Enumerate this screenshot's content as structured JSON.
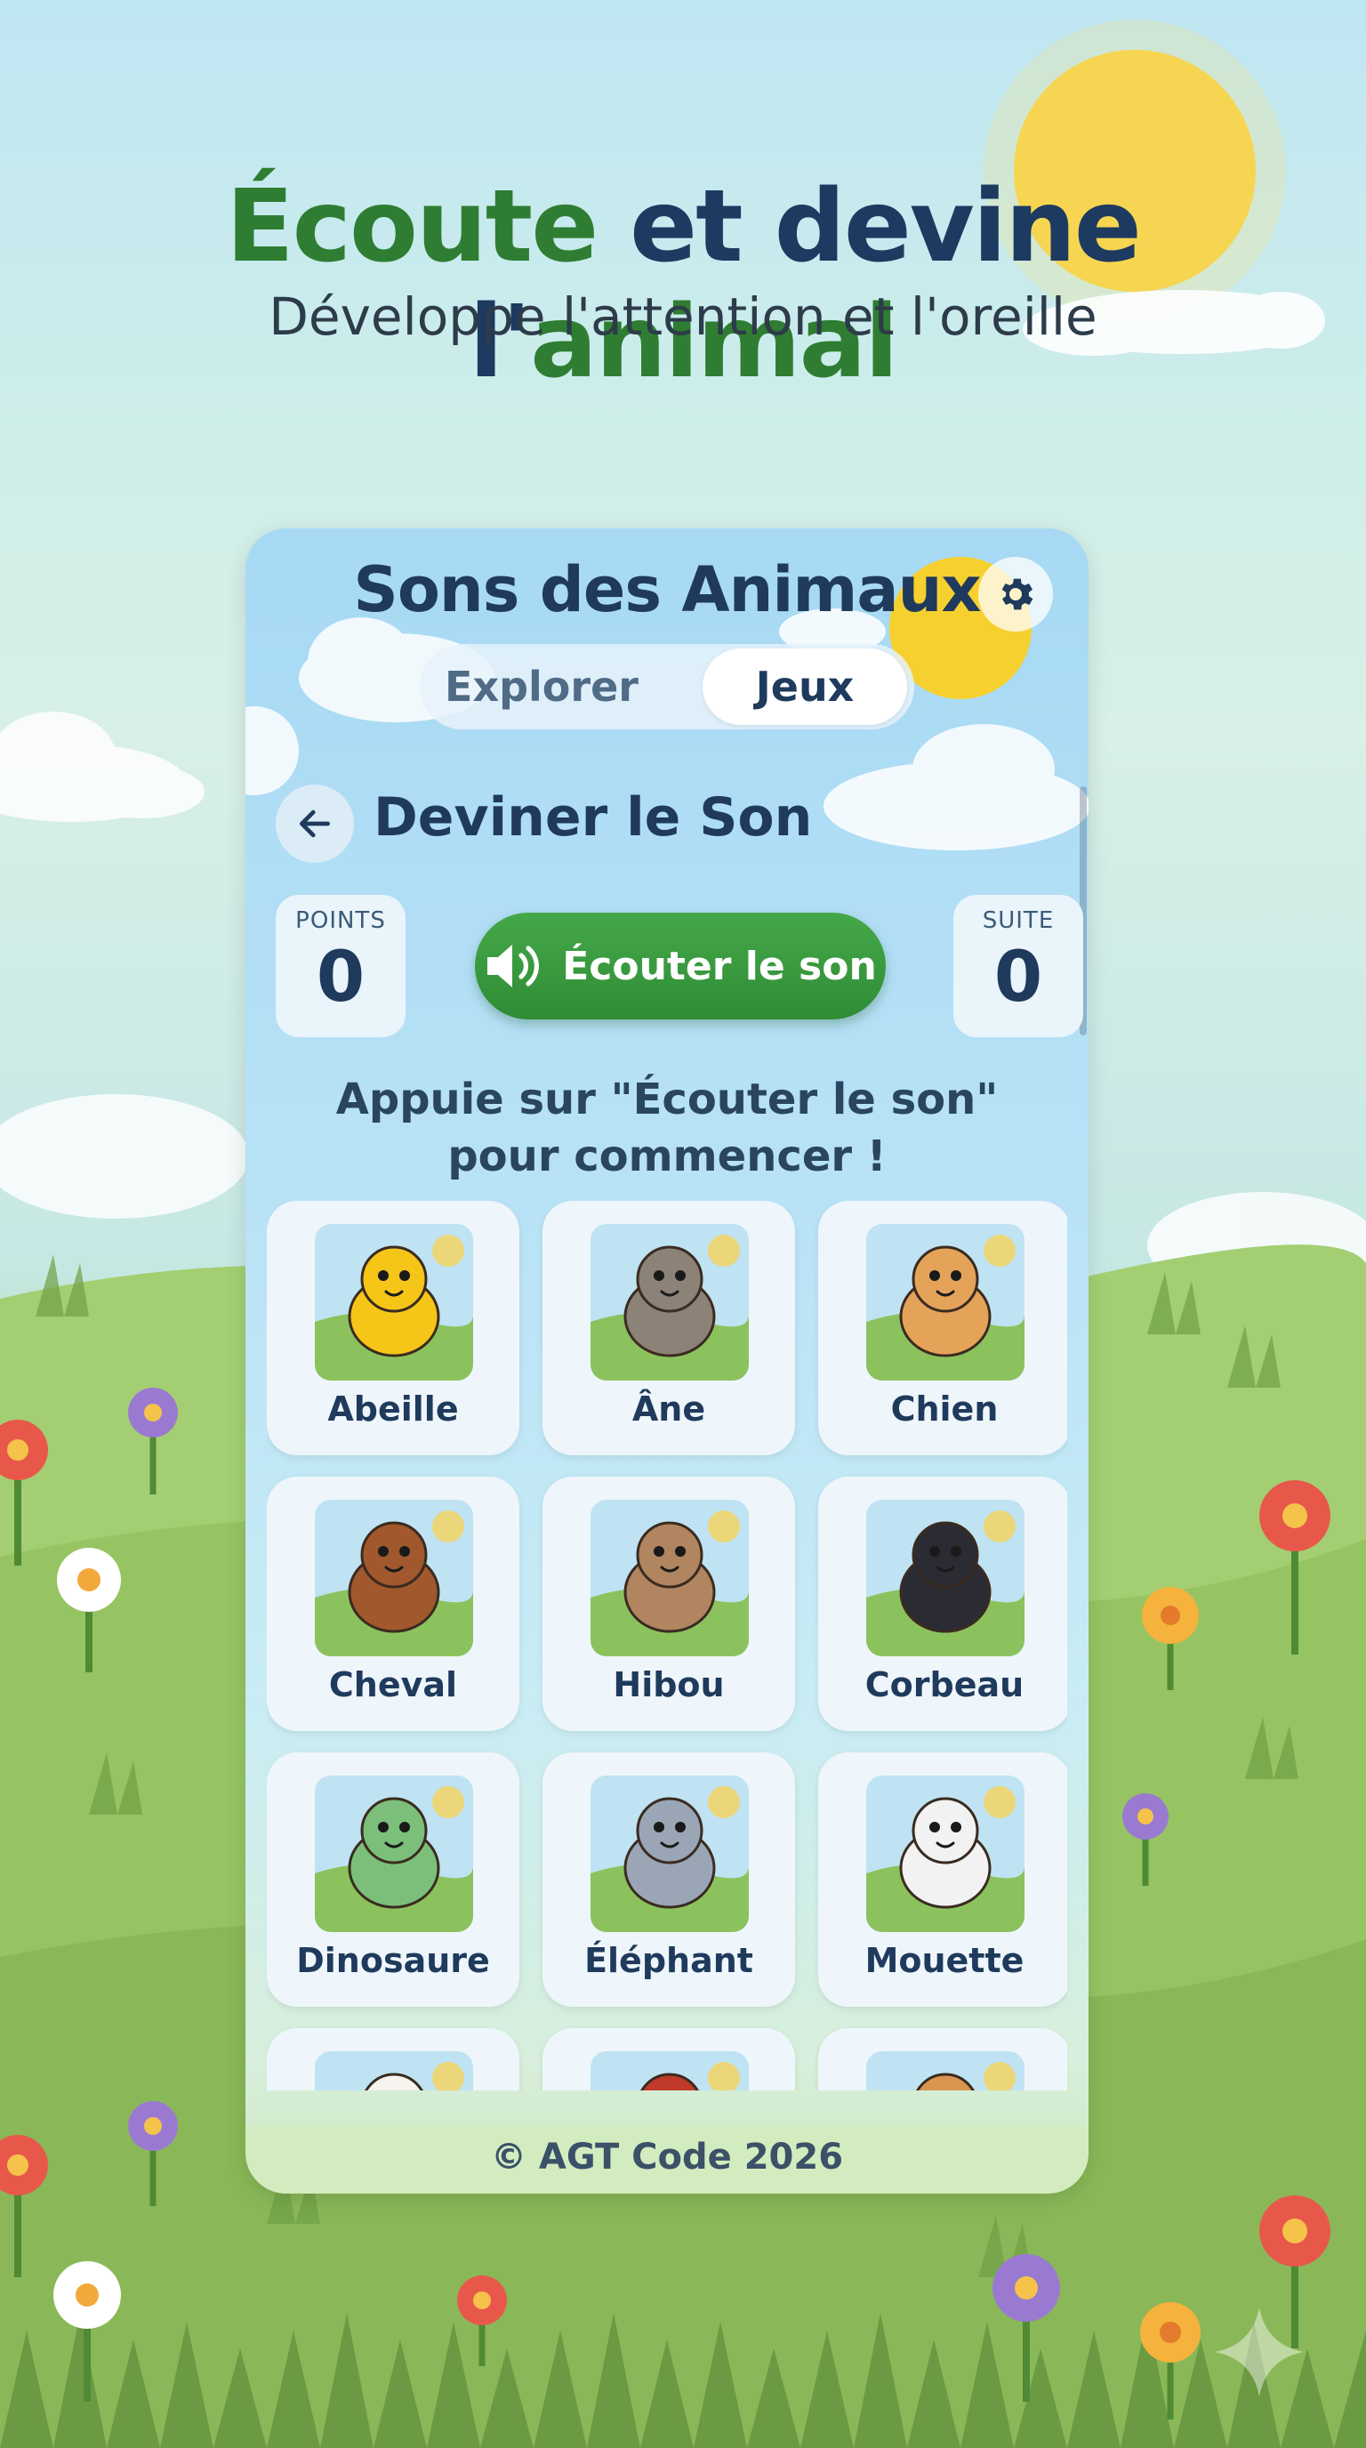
{
  "poster": {
    "headline_part1": "Écoute",
    "headline_part2": "et devine l'",
    "headline_part3": "animal",
    "subheadline": "Développe l'attention et l'oreille"
  },
  "app": {
    "title": "Sons des Animaux",
    "settings_icon": "gear-icon",
    "tabs": [
      {
        "label": "Explorer",
        "active": false
      },
      {
        "label": "Jeux",
        "active": true
      }
    ]
  },
  "screen": {
    "back_icon": "arrow-left-icon",
    "title": "Deviner le Son",
    "points": {
      "label": "POINTS",
      "value": "0"
    },
    "streak": {
      "label": "SUITE",
      "value": "0"
    },
    "listen_button": {
      "label": "Écouter le son",
      "icon": "speaker-icon"
    },
    "prompt": "Appuie sur \"Écouter le son\" pour commencer !"
  },
  "animals": [
    {
      "name": "Abeille",
      "icon": "bee",
      "color": "#f5c518"
    },
    {
      "name": "Âne",
      "icon": "donkey",
      "color": "#8c8278"
    },
    {
      "name": "Chien",
      "icon": "dog",
      "color": "#e5a35a"
    },
    {
      "name": "Cheval",
      "icon": "horse",
      "color": "#a0582c"
    },
    {
      "name": "Hibou",
      "icon": "owl",
      "color": "#b08560"
    },
    {
      "name": "Corbeau",
      "icon": "crow",
      "color": "#2b2b33"
    },
    {
      "name": "Dinosaure",
      "icon": "dinosaur",
      "color": "#7cbf7a"
    },
    {
      "name": "Éléphant",
      "icon": "elephant",
      "color": "#9aa6b6"
    },
    {
      "name": "Mouette",
      "icon": "seagull",
      "color": "#f2f2f2"
    },
    {
      "name": "",
      "icon": "chicken",
      "color": "#f7f3ee"
    },
    {
      "name": "",
      "icon": "rooster",
      "color": "#c0392b"
    },
    {
      "name": "",
      "icon": "cat",
      "color": "#d9954f"
    }
  ],
  "footer": {
    "text": "© AGT Code 2026"
  },
  "colors": {
    "primary_dark": "#1f3a5c",
    "green_button": "#3a9a3f",
    "headline_green": "#2f7d32"
  }
}
